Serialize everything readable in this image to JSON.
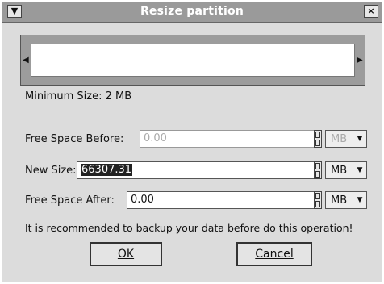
{
  "window": {
    "title": "Resize partition",
    "menu_icon": "chevron-down-icon",
    "close_icon": "close-icon"
  },
  "info": {
    "minimum_size": "Minimum Size: 2 MB"
  },
  "fields": {
    "free_before": {
      "label": "Free Space Before:",
      "value": "0.00",
      "unit": "MB",
      "disabled": true
    },
    "new_size": {
      "label": "New Size:",
      "value": "66307.31",
      "unit": "MB",
      "disabled": false
    },
    "free_after": {
      "label": "Free Space After:",
      "value": "0.00",
      "unit": "MB",
      "disabled": false
    }
  },
  "warning": "It is recommended to backup your data before do this operation!",
  "buttons": {
    "ok": "OK",
    "cancel": "Cancel"
  }
}
